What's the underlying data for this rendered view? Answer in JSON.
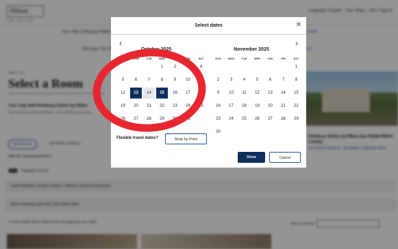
{
  "background": {
    "logo": "Hilton",
    "logo_sub": "FOR THE STAY",
    "top_links": "Language: English ·   Your Stays   ·   Join / Sign In",
    "search_summary": "Your stay:  Embassy Suites by Hilton San Rafael Marin County Conference Center",
    "search_link": "Edit room",
    "edit_summary": "Edit stay:  Oct 13 – Oct 15 · 1 Room, 1 Adult",
    "edit_link": "Rate #",
    "step": "Step 1 of 3",
    "heading": "Select a Room",
    "stay_line": "Your stay with Embassy Suites by Hilton",
    "stay_sub": "Free made-to-order breakfast · Free evening reception",
    "special_rates": "Special rates",
    "points_label": "Use Points & Money",
    "filter_label": "Filter By:   Connecting Rooms",
    "compare_label": "Compare 2 rooms",
    "hotel_name": "Embassy Suites by Hilton San Rafael Marin County",
    "hotel_addr": "101 McInnis Parkway, San Rafael, California 94903",
    "band1": "Daily Mandatory Charge Includes: California Tourism Assessment",
    "band2": "We're showing a price with 2025 Room rates",
    "rooms_found": "4 rooms found. We're showing the average price per night.",
    "currency_label": "Select currency",
    "currency_value": "USD - US Dollar"
  },
  "modal": {
    "title": "Select dates",
    "close_icon": "close-icon",
    "prev_icon": "chevron-left-icon",
    "next_icon": "chevron-right-icon",
    "weekdays": [
      "SUN",
      "MON",
      "TUE",
      "WED",
      "THU",
      "FRI",
      "SAT"
    ],
    "months": [
      {
        "name": "October 2025",
        "first_weekday": 3,
        "days": 31
      },
      {
        "name": "November 2025",
        "first_weekday": 6,
        "days": 30
      }
    ],
    "check_in": {
      "month": 0,
      "day": 13
    },
    "check_out": {
      "month": 0,
      "day": 15
    },
    "flexible_label": "Flexible travel dates?",
    "shop_by_price": "Shop by Price",
    "done": "Done",
    "cancel": "Cancel"
  },
  "annotation": {
    "color": "#e8262f"
  }
}
